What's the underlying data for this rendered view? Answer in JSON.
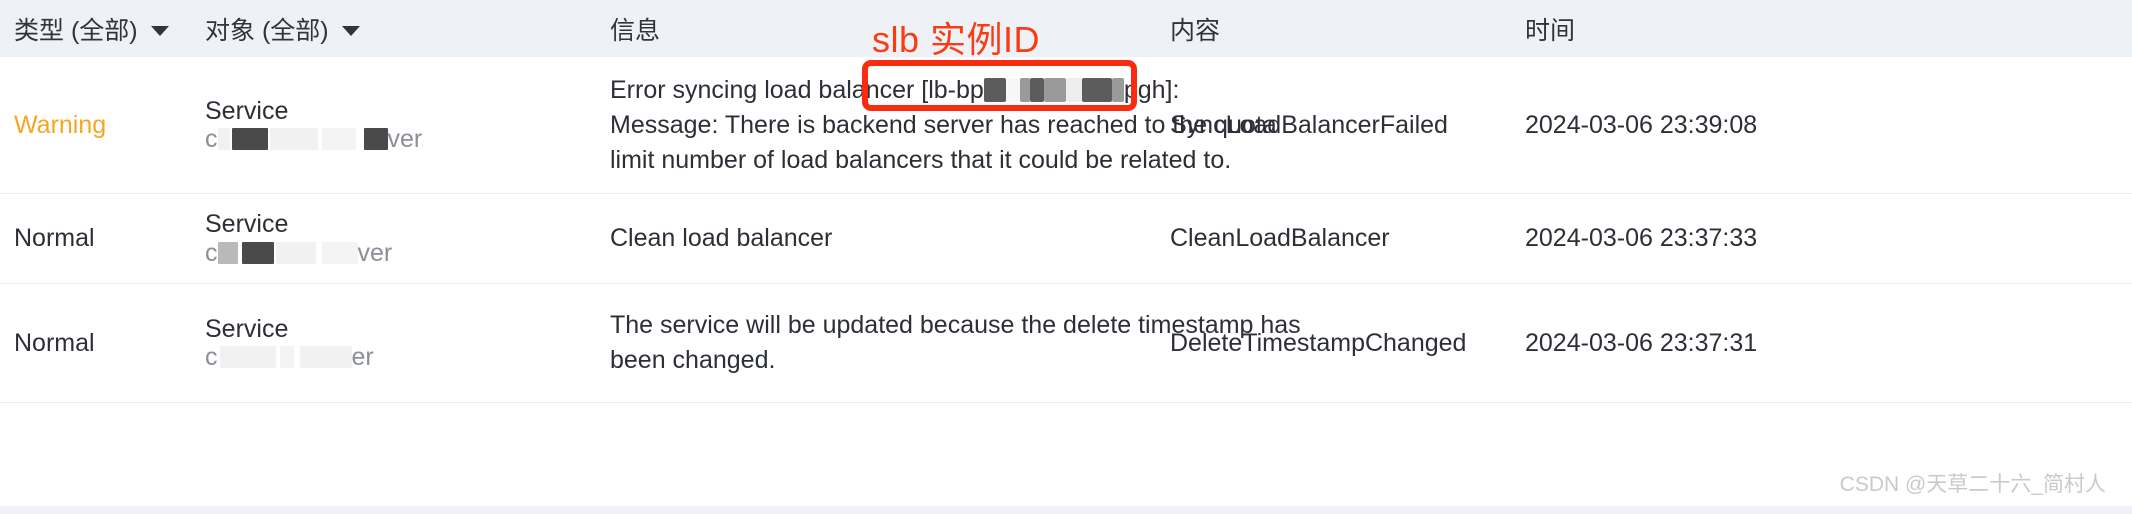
{
  "table": {
    "columns": [
      {
        "id": "type",
        "label": "类型 (全部)",
        "has_filter": true
      },
      {
        "id": "object",
        "label": "对象 (全部)",
        "has_filter": true
      },
      {
        "id": "info",
        "label": "信息",
        "has_filter": false
      },
      {
        "id": "content",
        "label": "内容",
        "has_filter": false
      },
      {
        "id": "time",
        "label": "时间",
        "has_filter": false
      }
    ],
    "rows": [
      {
        "type": "Warning",
        "type_color": "#f5a623",
        "object_kind": "Service",
        "object_name_prefix": "c",
        "object_name_suffix": "ver",
        "message_line1_before_id": "Error syncing load balancer",
        "message_id_prefix": "[lb-bp",
        "message_id_suffix": "pgh]:",
        "message_line2": "Message: There is backend server has reached to the quota",
        "message_line3": "limit number of load balancers that it could be related to.",
        "content": "SyncLoadBalancerFailed",
        "time": "2024-03-06 23:39:08"
      },
      {
        "type": "Normal",
        "type_color": "#2c2f36",
        "object_kind": "Service",
        "object_name_prefix": "c",
        "object_name_suffix": "ver",
        "message_line1": "Clean load balancer",
        "message_line2": "",
        "message_line3": "",
        "content": "CleanLoadBalancer",
        "time": "2024-03-06 23:37:33"
      },
      {
        "type": "Normal",
        "type_color": "#2c2f36",
        "object_kind": "Service",
        "object_name_prefix": "c",
        "object_name_suffix": "er",
        "message_line1": "The service will be updated because the delete timestamp has",
        "message_line2": "been changed.",
        "message_line3": "",
        "content": "DeleteTimestampChanged",
        "time": "2024-03-06 23:37:31"
      }
    ]
  },
  "annotation": {
    "label": "slb 实例ID",
    "color": "#fa3c14",
    "box_color": "#fa2c10"
  },
  "watermark": {
    "text": "CSDN @天草二十六_简村人"
  }
}
